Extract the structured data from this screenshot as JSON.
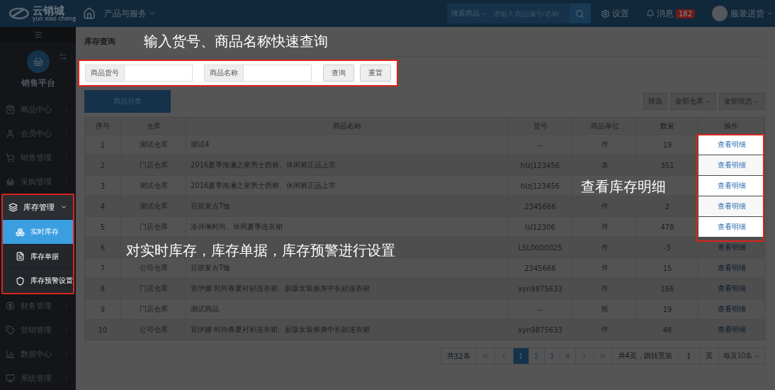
{
  "topbar": {
    "logo": "云销城",
    "logo_sub": "yun xiao cheng",
    "products_menu": "产品与服务",
    "search_scope": "搜索商品",
    "search_placeholder": "请输入商品编号/名称",
    "settings": "设置",
    "messages": "消息",
    "message_count": "182",
    "user": "服装进货"
  },
  "sidebar": {
    "platform": "销售平台",
    "items": [
      {
        "kind": "bag",
        "label": "商品中心",
        "expanded": false,
        "highlighted": false
      },
      {
        "kind": "user",
        "label": "会员中心",
        "expanded": false,
        "highlighted": false
      },
      {
        "kind": "cart",
        "label": "销售管理",
        "expanded": false,
        "highlighted": false
      },
      {
        "kind": "basket",
        "label": "采购管理",
        "expanded": false,
        "highlighted": false
      },
      {
        "kind": "layers",
        "label": "库存管理",
        "expanded": true,
        "highlighted": true,
        "children": [
          {
            "kind": "cluster",
            "label": "实时库存",
            "selected": true
          },
          {
            "kind": "doc",
            "label": "库存单据",
            "selected": false
          },
          {
            "kind": "shield",
            "label": "库存预警设置",
            "selected": false
          }
        ]
      },
      {
        "kind": "money",
        "label": "财务管理",
        "expanded": false,
        "highlighted": false
      },
      {
        "kind": "tag",
        "label": "营销管理",
        "expanded": false,
        "highlighted": false
      },
      {
        "kind": "chart",
        "label": "数据中心",
        "expanded": false,
        "highlighted": false
      },
      {
        "kind": "monitor",
        "label": "系统管理",
        "expanded": false,
        "highlighted": false
      }
    ]
  },
  "page_title": "库存查询",
  "search_panel": {
    "highlighted": true,
    "fields": [
      {
        "label": "商品货号"
      },
      {
        "label": "商品名称"
      }
    ],
    "buttons": [
      "查询",
      "重置"
    ]
  },
  "category_tab": "商品分类",
  "filters": [
    "筛选",
    "全部仓库",
    "全部状态"
  ],
  "table": {
    "columns": [
      "序号",
      "仓库",
      "商品名称",
      "货号",
      "商品单位",
      "数量",
      "操作"
    ],
    "rows": [
      {
        "no": "1",
        "warehouse": "测试仓库",
        "name": "测试4",
        "code": "--",
        "unit": "件",
        "qty": "19",
        "action": "查看明细",
        "highlighted": true
      },
      {
        "no": "2",
        "warehouse": "门店仓库",
        "name": "2016夏季海澜之家男士西裤、休闲裤正品上市",
        "code": "hlzj123456",
        "unit": "条",
        "qty": "351",
        "action": "查看明细",
        "highlighted": true
      },
      {
        "no": "3",
        "warehouse": "测试仓库",
        "name": "2016夏季海澜之家男士西裤、休闲裤正品上市",
        "code": "hlzj123456",
        "action": "查看明细",
        "highlighted": true
      },
      {
        "no": "4",
        "warehouse": "测试仓库",
        "name": "百搭复古T恤",
        "code": "2345666",
        "unit": "件",
        "qty": "2",
        "action": "查看明细",
        "highlighted": true
      },
      {
        "no": "5",
        "warehouse": "门店仓库",
        "name": "洛诗琳时尚、休闲夏季连衣裙",
        "code": "lsl12306",
        "unit": "件",
        "qty": "478",
        "action": "查看明细",
        "highlighted": true
      },
      {
        "no": "6",
        "code": "LSL0000025",
        "unit": "件",
        "qty": "-3",
        "action": "查看明细",
        "highlighted": false
      },
      {
        "no": "7",
        "warehouse": "公司仓库",
        "name": "百搭复古T恤",
        "code": "2345666",
        "unit": "件",
        "qty": "15",
        "action": "查看明细",
        "highlighted": false
      },
      {
        "no": "8",
        "warehouse": "门店仓库",
        "name": "宣伊娜 时尚春夏衬衫连衣裙、新版女装修身中长款连衣裙",
        "code": "xyn9875633",
        "unit": "件",
        "qty": "166",
        "action": "查看明细",
        "highlighted": false
      },
      {
        "no": "9",
        "warehouse": "门店仓库",
        "name": "测试商品",
        "code": "--",
        "unit": "瓶",
        "qty": "19",
        "action": "查看明细",
        "highlighted": false
      },
      {
        "no": "10",
        "warehouse": "公司仓库",
        "name": "宣伊娜 时尚春夏衬衫连衣裙、新版女装修身中长款连衣裙",
        "code": "xyn9875633",
        "unit": "件",
        "qty": "48",
        "action": "查看明细",
        "highlighted": false
      }
    ]
  },
  "pagination": {
    "total_prefix": "共",
    "total_count": "32",
    "total_suffix": "条",
    "pages": [
      {
        "label": "1",
        "selected": true
      },
      {
        "label": "2",
        "selected": false
      },
      {
        "label": "3",
        "selected": false
      },
      {
        "label": "4",
        "selected": false
      }
    ],
    "jump_label": "共4页，跳转至第",
    "jump_value": "1",
    "page_unit": "页",
    "page_size": "每页10条"
  },
  "annotations": [
    {
      "text": "输入货号、商品名称快速查询"
    },
    {
      "text": "查看库存明细"
    },
    {
      "text": "对实时库存，库存单据，库存预警进行设置"
    }
  ]
}
